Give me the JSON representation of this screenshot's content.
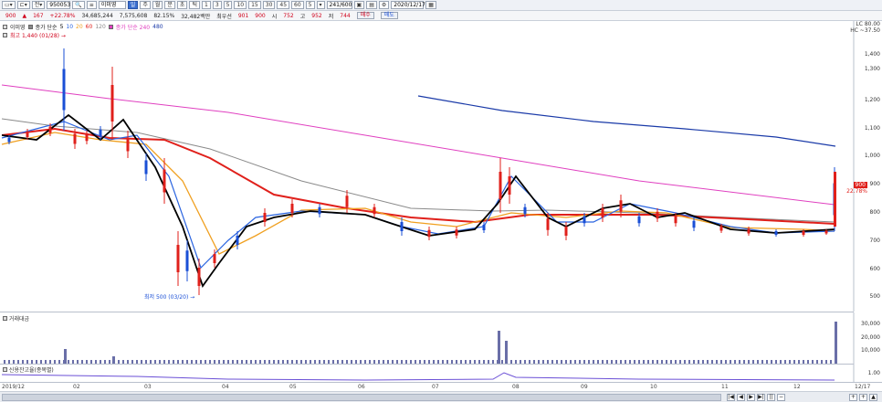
{
  "toolbar": {
    "symbol_code": "950053",
    "symbol_name": "이미영",
    "period": "일",
    "period_options": [
      "일",
      "주",
      "월",
      "분",
      "초",
      "틱"
    ],
    "intervals": [
      "1",
      "3",
      "5",
      "10",
      "15",
      "30",
      "45",
      "60",
      "5"
    ],
    "count": "241/600",
    "date": "2020/12/17"
  },
  "quote": {
    "price": "900",
    "change": "167",
    "change_pct": "+22.78%",
    "volume": "34,685,244",
    "amount": "7,575,608",
    "volume_pct": "82.15%",
    "trade_value": "32,482백만",
    "best_bid_label": "최우선",
    "best_bid": "901",
    "best_ask": "900",
    "open_label": "시",
    "open": "752",
    "high_label": "고",
    "high": "952",
    "low_label": "저",
    "low": "744",
    "buy_label": "매수",
    "sell_label": "매도"
  },
  "legend": {
    "price_label": "이미영",
    "ma_label": "종가 단순",
    "ma_periods": [
      "5",
      "10",
      "20",
      "60",
      "120"
    ],
    "ma2_label": "종가 단순 240",
    "ma2_extra": "480",
    "high_note": "최고 1,440 (01/28) →",
    "low_note": "최저 500 (03/20) →"
  },
  "y_axis_price": [
    "1,400",
    "1,300",
    "1,200",
    "1,100",
    "1,000",
    "900",
    "800",
    "700",
    "600",
    "500"
  ],
  "right_top": [
    "LC 80.00",
    "HC ~37.50"
  ],
  "current_badge": "900",
  "current_pct": "22.78%",
  "volume_panel": {
    "title": "거래대금",
    "ticks": [
      "30,000",
      "20,000",
      "10,000"
    ]
  },
  "credit_panel": {
    "title": "신용잔고율(종목별)",
    "ticks": [
      "1.00"
    ]
  },
  "x_axis": [
    "2019/12",
    "02",
    "03",
    "04",
    "05",
    "06",
    "07",
    "08",
    "09",
    "10",
    "11",
    "12",
    "12/17"
  ],
  "colors": {
    "ma5": "#000000",
    "ma10": "#2a64e0",
    "ma20": "#f0a020",
    "ma60": "#e0201b",
    "ma120": "#8a8a8a",
    "ma240": "#e040c0",
    "ma480": "#1a3aa8"
  }
}
